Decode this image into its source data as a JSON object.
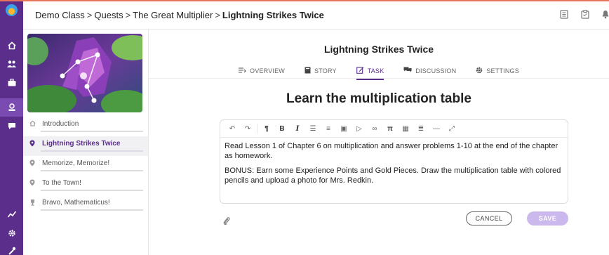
{
  "header": {
    "breadcrumbs": [
      "Demo Class",
      "Quests",
      "The Great Multiplier"
    ],
    "current": "Lightning Strikes Twice",
    "separator": ">"
  },
  "rail": {
    "icons": [
      "logo",
      "home-icon",
      "users-icon",
      "briefcase-icon",
      "quest-icon",
      "chat-icon",
      "chart-icon",
      "gear-icon",
      "tools-icon"
    ]
  },
  "quests": [
    {
      "label": "Introduction",
      "icon": "home-icon"
    },
    {
      "label": "Lightning Strikes Twice",
      "icon": "map-pin-icon",
      "active": true
    },
    {
      "label": "Memorize, Memorize!",
      "icon": "map-pin-icon"
    },
    {
      "label": "To the Town!",
      "icon": "map-pin-icon"
    },
    {
      "label": "Bravo, Mathematicus!",
      "icon": "trophy-icon"
    }
  ],
  "main": {
    "quest_title": "Lightning Strikes Twice",
    "tabs": [
      {
        "label": "OVERVIEW",
        "icon": "overview-icon"
      },
      {
        "label": "STORY",
        "icon": "book-icon"
      },
      {
        "label": "TASK",
        "icon": "edit-icon",
        "active": true
      },
      {
        "label": "DISCUSSION",
        "icon": "discussion-icon"
      },
      {
        "label": "SETTINGS",
        "icon": "gear-icon"
      }
    ],
    "task_title": "Learn the multiplication table",
    "editor": {
      "paragraph1": "Read Lesson 1 of Chapter 6 on multiplication and answer problems 1-10 at the end of the chapter as homework.",
      "paragraph2": "BONUS: Earn some Experience Points and Gold Pieces. Draw the multiplication table with colored pencils and upload a photo for Mrs. Redkin."
    },
    "cancel_label": "CANCEL",
    "save_label": "SAVE"
  },
  "colors": {
    "accent": "#5b2e8c",
    "save_disabled": "#cbb8ec",
    "topline": "#e8745a"
  }
}
